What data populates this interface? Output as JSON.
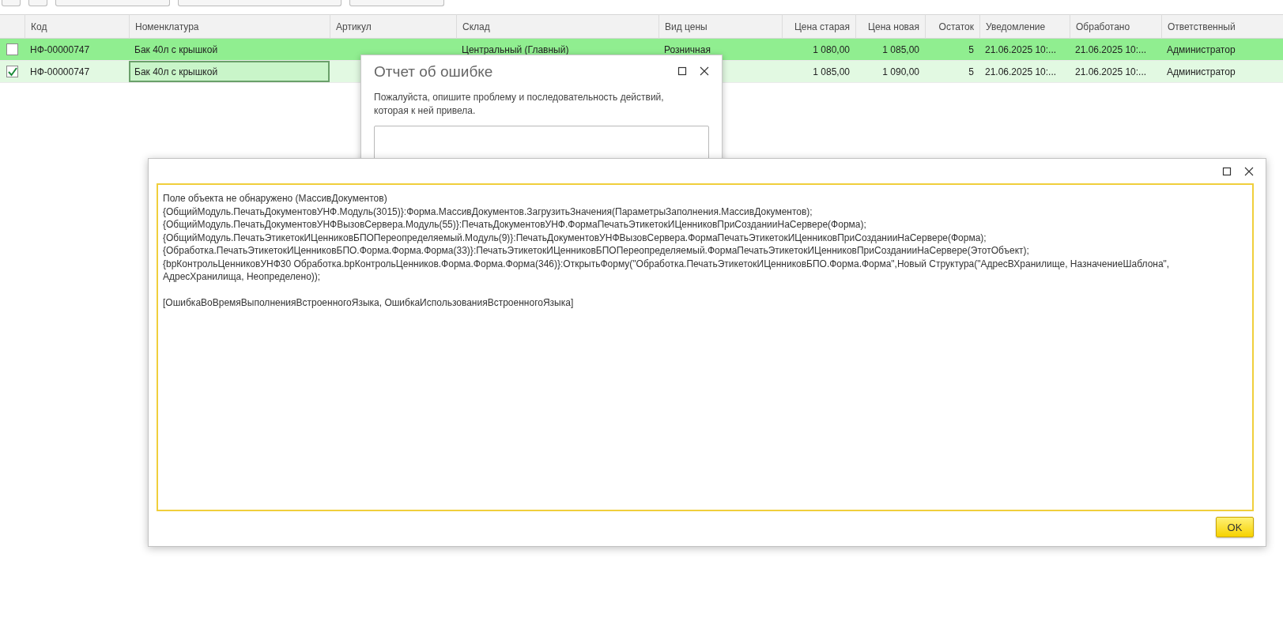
{
  "toolbar": [
    {
      "kind": "small"
    },
    {
      "kind": "small"
    },
    {
      "kind": "wide"
    },
    {
      "kind": "wider"
    },
    {
      "kind": "medium"
    }
  ],
  "table": {
    "columns": [
      {
        "label": "Код",
        "numeric": false
      },
      {
        "label": "Номенклатура",
        "numeric": false
      },
      {
        "label": "Артикул",
        "numeric": false
      },
      {
        "label": "Склад",
        "numeric": false
      },
      {
        "label": "Вид цены",
        "numeric": false
      },
      {
        "label": "Цена старая",
        "numeric": true
      },
      {
        "label": "Цена новая",
        "numeric": true
      },
      {
        "label": "Остаток",
        "numeric": true
      },
      {
        "label": "Уведомление",
        "numeric": false
      },
      {
        "label": "Обработано",
        "numeric": false
      },
      {
        "label": "Ответственный",
        "numeric": false
      }
    ],
    "rows": [
      {
        "checked": false,
        "color": "#90ee90",
        "nomenclature_focused": false,
        "code": "НФ-00000747",
        "nomenclature": "Бак 40л с крышкой",
        "warehouse": "Центральный (Главный)",
        "price_type": "Розничная",
        "old_price": "1 080,00",
        "new_price": "1 085,00",
        "stock": "5",
        "notified": "21.06.2025 10:...",
        "processed": "21.06.2025 10:...",
        "responsible": "Администратор"
      },
      {
        "checked": true,
        "color": "#e2f9e2",
        "nomenclature_focused": true,
        "code": "НФ-00000747",
        "nomenclature": "Бак 40л с крышкой",
        "old_price": "1 085,00",
        "new_price": "1 090,00",
        "stock": "5",
        "notified": "21.06.2025 10:...",
        "processed": "21.06.2025 10:...",
        "responsible": "Администратор"
      }
    ]
  },
  "report_dialog": {
    "title": "Отчет об ошибке",
    "description": "Пожалуйста, опишите проблему и последовательность действий, которая к ней привела."
  },
  "error_dialog": {
    "lines": [
      "Поле объекта не обнаружено (МассивДокументов)",
      "{ОбщийМодуль.ПечатьДокументовУНФ.Модуль(3015)}:Форма.МассивДокументов.ЗагрузитьЗначения(ПараметрыЗаполнения.МассивДокументов);",
      "{ОбщийМодуль.ПечатьДокументовУНФВызовСервера.Модуль(55)}:ПечатьДокументовУНФ.ФормаПечатьЭтикетокИЦенниковПриСозданииНаСервере(Форма);",
      "{ОбщийМодуль.ПечатьЭтикетокИЦенниковБПОПереопределяемый.Модуль(9)}:ПечатьДокументовУНФВызовСервера.ФормаПечатьЭтикетокИЦенниковПриСозданииНаСервере(Форма);",
      "{Обработка.ПечатьЭтикетокИЦенниковБПО.Форма.Форма.Форма(33)}:ПечатьЭтикетокИЦенниковБПОПереопределяемый.ФормаПечатьЭтикетокИЦенниковПриСозданииНаСервере(ЭтотОбъект);",
      "{bpКонтрольЦенниковУНФ30 Обработка.bpКонтрольЦенников.Форма.Форма.Форма(346)}:ОткрытьФорму(\"Обработка.ПечатьЭтикетокИЦенниковБПО.Форма.Форма\",Новый Структура(\"АдресВХранилище, НазначениеШаблона\",",
      "АдресХранилища, Неопределено));"
    ],
    "error_kinds": "[ОшибкаВоВремяВыполненияВстроенногоЯзыка, ОшибкаИспользованияВстроенногоЯзыка]",
    "ok_label": "OK"
  }
}
